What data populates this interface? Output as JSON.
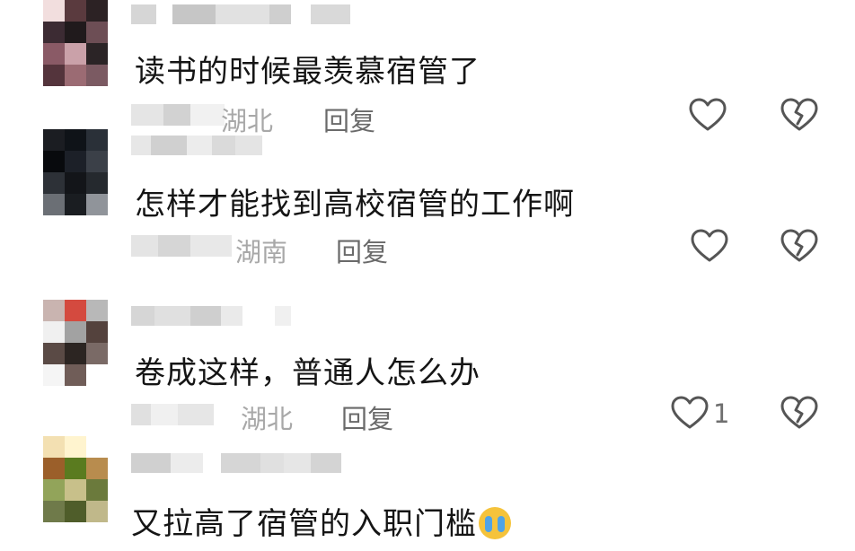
{
  "comments": [
    {
      "text": "读书的时候最羡慕宿管了",
      "location": "湖北",
      "reply_label": "回复",
      "likes": ""
    },
    {
      "text": "怎样才能找到高校宿管的工作啊",
      "location": "湖南",
      "reply_label": "回复",
      "likes": ""
    },
    {
      "text": "卷成这样，普通人怎么办",
      "location": "湖北",
      "reply_label": "回复",
      "likes": "1"
    },
    {
      "text": "又拉高了宿管的入职门槛",
      "emoji": "loudly-crying-face",
      "location": "",
      "reply_label": "",
      "likes": ""
    }
  ],
  "icons": {
    "like": "heart-outline-icon",
    "dislike": "broken-heart-icon"
  },
  "colors": {
    "text": "#151515",
    "meta": "#a8a8a8",
    "reply": "#6a6a6a",
    "icon": "#555555"
  }
}
